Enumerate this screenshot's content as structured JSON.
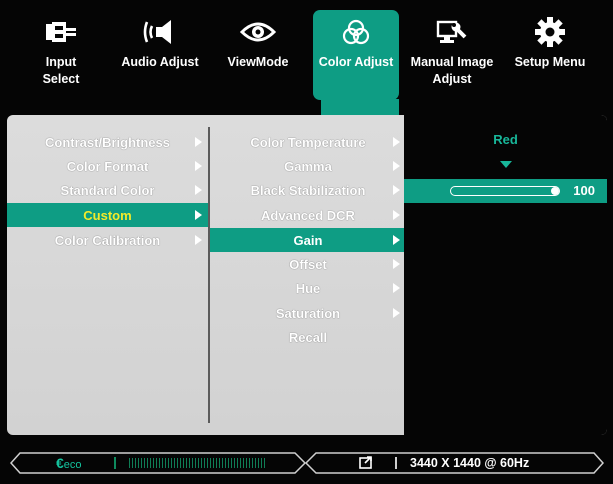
{
  "tabs": [
    {
      "label": "Input\nSelect",
      "icon": "input-plug-icon",
      "active": false
    },
    {
      "label": "Audio Adjust",
      "icon": "speaker-icon",
      "active": false
    },
    {
      "label": "ViewMode",
      "icon": "eye-icon",
      "active": false
    },
    {
      "label": "Color Adjust",
      "icon": "color-circles-icon",
      "active": true
    },
    {
      "label": "Manual Image\nAdjust",
      "icon": "monitor-wrench-icon",
      "active": false
    },
    {
      "label": "Setup Menu",
      "icon": "gear-icon",
      "active": false
    }
  ],
  "menu1": {
    "items": [
      {
        "label": "Contrast/Brightness",
        "arrow": true
      },
      {
        "label": "Color Format",
        "arrow": true
      },
      {
        "label": "Standard Color",
        "arrow": true
      },
      {
        "label": "Custom",
        "arrow": true,
        "selected": true
      },
      {
        "label": "Color Calibration",
        "arrow": true
      }
    ]
  },
  "menu2": {
    "items": [
      {
        "label": "Color Temperature",
        "arrow": true
      },
      {
        "label": "Gamma",
        "arrow": true
      },
      {
        "label": "Black Stabilization",
        "arrow": true
      },
      {
        "label": "Advanced DCR",
        "arrow": true
      },
      {
        "label": "Gain",
        "arrow": true,
        "selected": true
      },
      {
        "label": "Offset",
        "arrow": true
      },
      {
        "label": "Hue",
        "arrow": true
      },
      {
        "label": "Saturation",
        "arrow": true
      },
      {
        "label": "Recall",
        "arrow": false
      }
    ]
  },
  "gain_panel": {
    "channel": "Red",
    "value": "100",
    "level_percent": 100
  },
  "status_bar": {
    "eco_label": "eco",
    "resolution": "3440 X 1440 @ 60Hz",
    "input_icon": "input-source-icon"
  },
  "colors": {
    "accent": "#0e9d84",
    "highlight_text": "#f2ea2b",
    "eco_green": "#14c39e",
    "panel_bg": "#d6d6d6"
  }
}
